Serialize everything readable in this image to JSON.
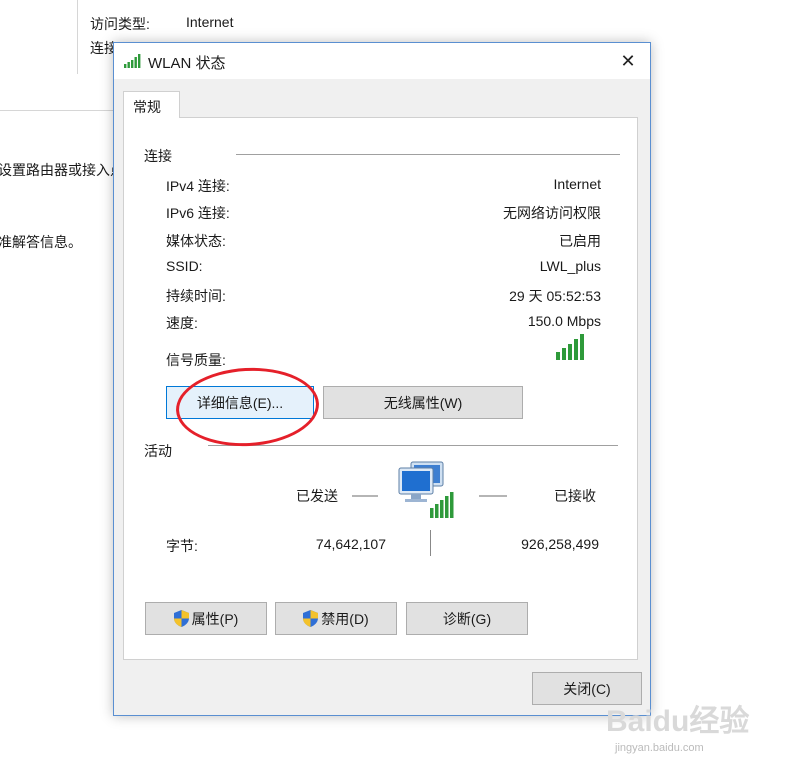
{
  "background_window": {
    "access_type_label": "访问类型:",
    "access_type_value": "Internet",
    "connection_label": "连接:",
    "text_fragment_1": "设置路由器或接入点",
    "text_fragment_2": "准解答信息。"
  },
  "dialog": {
    "title": "WLAN 状态",
    "close_glyph": "✕",
    "tab_general": "常规",
    "connection_group": "连接",
    "rows": [
      {
        "label": "IPv4 连接:",
        "value": "Internet"
      },
      {
        "label": "IPv6 连接:",
        "value": "无网络访问权限"
      },
      {
        "label": "媒体状态:",
        "value": "已启用"
      },
      {
        "label": "SSID:",
        "value": "LWL_plus"
      },
      {
        "label": "持续时间:",
        "value": "29 天 05:52:53"
      },
      {
        "label": "速度:",
        "value": "150.0 Mbps"
      }
    ],
    "signal_quality_label": "信号质量:",
    "signal_bars": 5,
    "details_button": "详细信息(E)...",
    "wireless_props_button": "无线属性(W)",
    "activity_group": "活动",
    "sent_label": "已发送",
    "received_label": "已接收",
    "bytes_label": "字节:",
    "bytes_sent": "74,642,107",
    "bytes_received": "926,258,499",
    "properties_button": "属性(P)",
    "disable_button": "禁用(D)",
    "diagnose_button": "诊断(G)",
    "close_button": "关闭(C)"
  },
  "watermark": {
    "brand": "Baidu经验",
    "url": "jingyan.baidu.com"
  },
  "colors": {
    "accent_blue": "#0078d7",
    "signal_green": "#2e9a3a",
    "highlight_red": "#e5202a"
  }
}
